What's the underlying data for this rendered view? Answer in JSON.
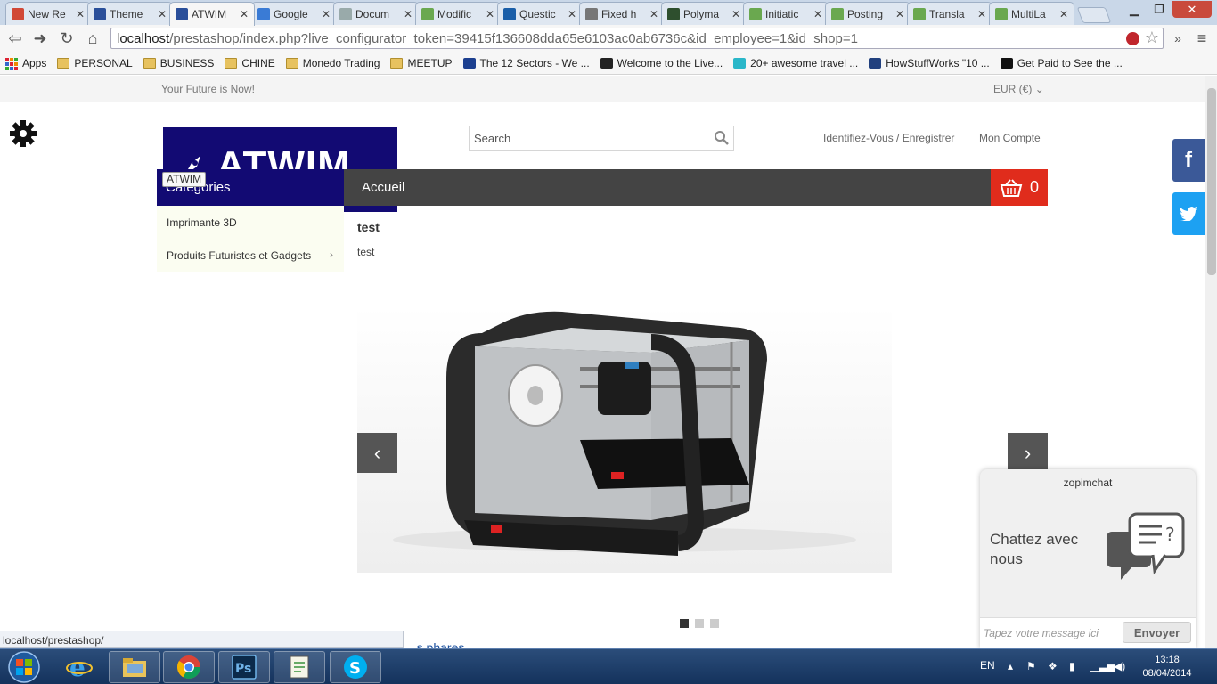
{
  "browser": {
    "tabs": [
      {
        "label": "New Re",
        "icon": "gmail-icon",
        "color": "#d14836"
      },
      {
        "label": "Theme",
        "icon": "prestashop-icon",
        "color": "#2a4f9a"
      },
      {
        "label": "ATWIM",
        "icon": "prestashop-icon",
        "color": "#2a4f9a"
      },
      {
        "label": "Google",
        "icon": "translate-icon",
        "color": "#3a7bd5"
      },
      {
        "label": "Docum",
        "icon": "document-icon",
        "color": "#9aa"
      },
      {
        "label": "Modific",
        "icon": "forum-icon",
        "color": "#6aa84f"
      },
      {
        "label": "Questic",
        "icon": "x-icon",
        "color": "#1a5ea8"
      },
      {
        "label": "Fixed h",
        "icon": "tools-icon",
        "color": "#777"
      },
      {
        "label": "Polyma",
        "icon": "k-icon",
        "color": "#2e4f2e"
      },
      {
        "label": "Initiatic",
        "icon": "forum-icon",
        "color": "#6aa84f"
      },
      {
        "label": "Posting",
        "icon": "forum-icon",
        "color": "#6aa84f"
      },
      {
        "label": "Transla",
        "icon": "forum-icon",
        "color": "#6aa84f"
      },
      {
        "label": "MultiLa",
        "icon": "forum-icon",
        "color": "#6aa84f"
      }
    ],
    "active_tab_index": 2,
    "close_glyph": "✕",
    "url_host": "localhost",
    "url_rest": "/prestashop/index.php?live_configurator_token=39415f136608dda65e6103ac0ab6736c&id_employee=1&id_shop=1",
    "more_glyph": "»",
    "menu_glyph": "≡",
    "bookmarks": [
      {
        "label": "Apps",
        "icon": "apps-icon"
      },
      {
        "label": "PERSONAL",
        "icon": "folder-icon"
      },
      {
        "label": "BUSINESS",
        "icon": "folder-icon"
      },
      {
        "label": "CHINE",
        "icon": "folder-icon"
      },
      {
        "label": "Monedo Trading",
        "icon": "folder-icon"
      },
      {
        "label": "MEETUP",
        "icon": "folder-icon"
      },
      {
        "label": "The 12 Sectors - We ...",
        "icon": "sectors-icon"
      },
      {
        "label": "Welcome to the Live...",
        "icon": "live-icon"
      },
      {
        "label": "20+ awesome travel ...",
        "icon": "travel-icon"
      },
      {
        "label": "HowStuffWorks \"10 ...",
        "icon": "howstuffworks-icon"
      },
      {
        "label": "Get Paid to See the ...",
        "icon": "b-icon"
      }
    ]
  },
  "shop": {
    "tagline": "Your Future is Now!",
    "currency": "EUR (€)",
    "logo_text": "ATWIM",
    "logo_tooltip": "ATWIM",
    "search_placeholder": "Search",
    "login_label": "Identifiez-Vous / Enregistrer",
    "account_label": "Mon Compte",
    "categories_title": "Catégories",
    "nav_home": "Accueil",
    "cart_count": "0",
    "categories": [
      {
        "label": "Imprimante 3D",
        "has_children": false
      },
      {
        "label": "Produits Futuristes et Gadgets",
        "has_children": true
      }
    ],
    "content_title": "test",
    "content_text": "test",
    "slider_total": 3,
    "slider_active": 0,
    "below_link": "...s phares",
    "colors": {
      "brand": "#120a73",
      "menu": "#444444",
      "cart": "#e02c1c",
      "facebook": "#3b5998",
      "twitter": "#1da1f2"
    }
  },
  "chat": {
    "brand": "zopimchat",
    "prompt": "Chattez avec nous",
    "input_placeholder": "Tapez votre message ici",
    "send_label": "Envoyer"
  },
  "status_url": "localhost/prestashop/",
  "taskbar": {
    "apps": [
      "internet-explorer-icon",
      "file-explorer-icon",
      "chrome-icon",
      "photoshop-icon",
      "notepad-plus-icon",
      "skype-icon"
    ],
    "language": "EN",
    "time": "13:18",
    "date": "08/04/2014"
  }
}
